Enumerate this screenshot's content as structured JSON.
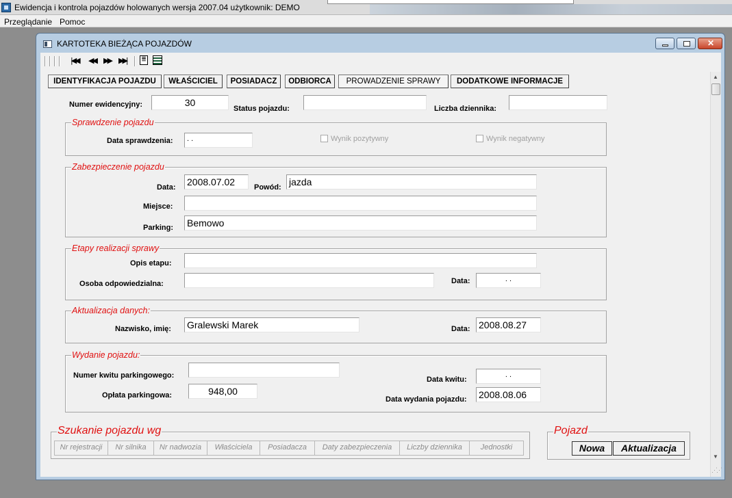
{
  "app": {
    "title": "Ewidencja i kontrola pojazdów holowanych   wersja 2007.04    użytkownik: DEMO"
  },
  "menu": [
    "Przeglądanie",
    "Pomoc"
  ],
  "window": {
    "title": "KARTOTEKA BIEŻĄCA POJAZDÓW"
  },
  "tabs": [
    {
      "label": "IDENTYFIKACJA POJAZDU"
    },
    {
      "label": "WŁAŚCICIEL"
    },
    {
      "label": "POSIADACZ"
    },
    {
      "label": "ODBIORCA"
    },
    {
      "label": "PROWADZENIE SPRAWY",
      "active": true
    },
    {
      "label": "DODATKOWE INFORMACJE"
    }
  ],
  "header": {
    "numer_label": "Numer ewidencyjny:",
    "numer_value": "30",
    "status_label": "Status pojazdu:",
    "status_value": "",
    "liczba_label": "Liczba dziennika:",
    "liczba_value": ""
  },
  "sprawdzenie": {
    "legend": "Sprawdzenie pojazdu",
    "data_label": "Data sprawdzenia:",
    "data_value": " .  .",
    "pozytywny": "Wynik pozytywny",
    "negatywny": "Wynik negatywny"
  },
  "zabezpieczenie": {
    "legend": "Zabezpieczenie pojazdu",
    "data_label": "Data:",
    "data_value": "2008.07.02",
    "powod_label": "Powód:",
    "powod_value": "jazda",
    "miejsce_label": "Miejsce:",
    "miejsce_value": "",
    "parking_label": "Parking:",
    "parking_value": "Bemowo"
  },
  "etapy": {
    "legend": "Etapy realizacji sprawy",
    "opis_label": "Opis etapu:",
    "opis_value": "",
    "osoba_label": "Osoba odpowiedzialna:",
    "osoba_value": "",
    "data_label": "Data:",
    "data_value": " .  ."
  },
  "aktualizacja": {
    "legend": "Aktualizacja danych:",
    "nazwisko_label": "Nazwisko, imię:",
    "nazwisko_value": "Gralewski Marek",
    "data_label": "Data:",
    "data_value": "2008.08.27"
  },
  "wydanie": {
    "legend": "Wydanie pojazdu:",
    "kwit_label": "Numer kwitu parkingowego:",
    "kwit_value": "",
    "oplata_label": "Opłata parkingowa:",
    "oplata_value": "948,00",
    "data_kwitu_label": "Data kwitu:",
    "data_kwitu_value": " .  .",
    "data_wydania_label": "Data wydania pojazdu:",
    "data_wydania_value": "2008.08.06"
  },
  "szukanie": {
    "legend": "Szukanie pojazdu wg",
    "columns": [
      "Nr rejestracji",
      "Nr silnika",
      "Nr nadwozia",
      "Właściciela",
      "Posiadacza",
      "Daty zabezpieczenia",
      "Liczby dziennika",
      "Jednostki"
    ]
  },
  "pojazd": {
    "legend": "Pojazd",
    "nowa": "Nowa",
    "aktualizacja": "Aktualizacja"
  },
  "icons": [
    "app-icon",
    "window-icon",
    "first-record-icon",
    "prev-record-icon",
    "next-record-icon",
    "last-record-icon",
    "list-icon",
    "grid-icon"
  ]
}
